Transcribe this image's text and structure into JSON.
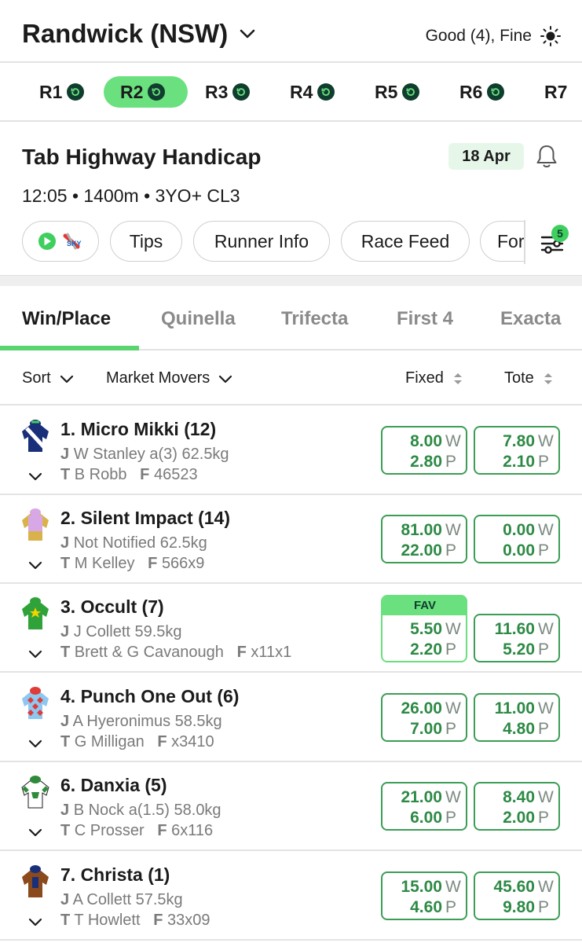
{
  "header": {
    "venue": "Randwick (NSW)",
    "weather": "Good (4), Fine"
  },
  "races": [
    {
      "label": "R1",
      "active": false
    },
    {
      "label": "R2",
      "active": true
    },
    {
      "label": "R3",
      "active": false
    },
    {
      "label": "R4",
      "active": false
    },
    {
      "label": "R5",
      "active": false
    },
    {
      "label": "R6",
      "active": false
    },
    {
      "label": "R7",
      "active": false
    }
  ],
  "race": {
    "title": "Tab Highway Handicap",
    "date": "18 Apr",
    "meta": "12:05 • 1400m • 3YO+ CL3",
    "pills": [
      "Tips",
      "Runner Info",
      "Race Feed",
      "Form"
    ],
    "filter_count": "5"
  },
  "bet_tabs": [
    "Win/Place",
    "Quinella",
    "Trifecta",
    "First 4",
    "Exacta"
  ],
  "sort": {
    "sort_label": "Sort",
    "market_movers": "Market Movers",
    "fixed": "Fixed",
    "tote": "Tote"
  },
  "labels": {
    "win": "W",
    "place": "P",
    "jockey": "J",
    "trainer": "T",
    "form": "F",
    "fav": "FAV"
  },
  "runners": [
    {
      "name": "1. Micro Mikki (12)",
      "jockey": "W Stanley a(3) 62.5kg",
      "trainer": "B Robb",
      "form": "46523",
      "fixed_win": "8.00",
      "fixed_place": "2.80",
      "tote_win": "7.80",
      "tote_place": "2.10",
      "fav": false
    },
    {
      "name": "2. Silent Impact (14)",
      "jockey": "Not Notified 62.5kg",
      "trainer": "M Kelley",
      "form": "566x9",
      "fixed_win": "81.00",
      "fixed_place": "22.00",
      "tote_win": "0.00",
      "tote_place": "0.00",
      "fav": false
    },
    {
      "name": "3. Occult (7)",
      "jockey": "J Collett 59.5kg",
      "trainer": "Brett & G Cavanough",
      "form": "x11x1",
      "fixed_win": "5.50",
      "fixed_place": "2.20",
      "tote_win": "11.60",
      "tote_place": "5.20",
      "fav": true
    },
    {
      "name": "4. Punch One Out (6)",
      "jockey": "A Hyeronimus 58.5kg",
      "trainer": "G Milligan",
      "form": "x3410",
      "fixed_win": "26.00",
      "fixed_place": "7.00",
      "tote_win": "11.00",
      "tote_place": "4.80",
      "fav": false
    },
    {
      "name": "6. Danxia (5)",
      "jockey": "B Nock a(1.5) 58.0kg",
      "trainer": "C Prosser",
      "form": "6x116",
      "fixed_win": "21.00",
      "fixed_place": "6.00",
      "tote_win": "8.40",
      "tote_place": "2.00",
      "fav": false
    },
    {
      "name": "7. Christa (1)",
      "jockey": "A Collett 57.5kg",
      "trainer": "T Howlett",
      "form": "33x09",
      "fixed_win": "15.00",
      "fixed_place": "4.60",
      "tote_win": "45.60",
      "tote_place": "9.80",
      "fav": false
    }
  ],
  "colors": {
    "accent": "#6be07f",
    "odds_border": "#3c9d55",
    "odds_text": "#2d8a45",
    "dark_green": "#0f3d2e"
  }
}
